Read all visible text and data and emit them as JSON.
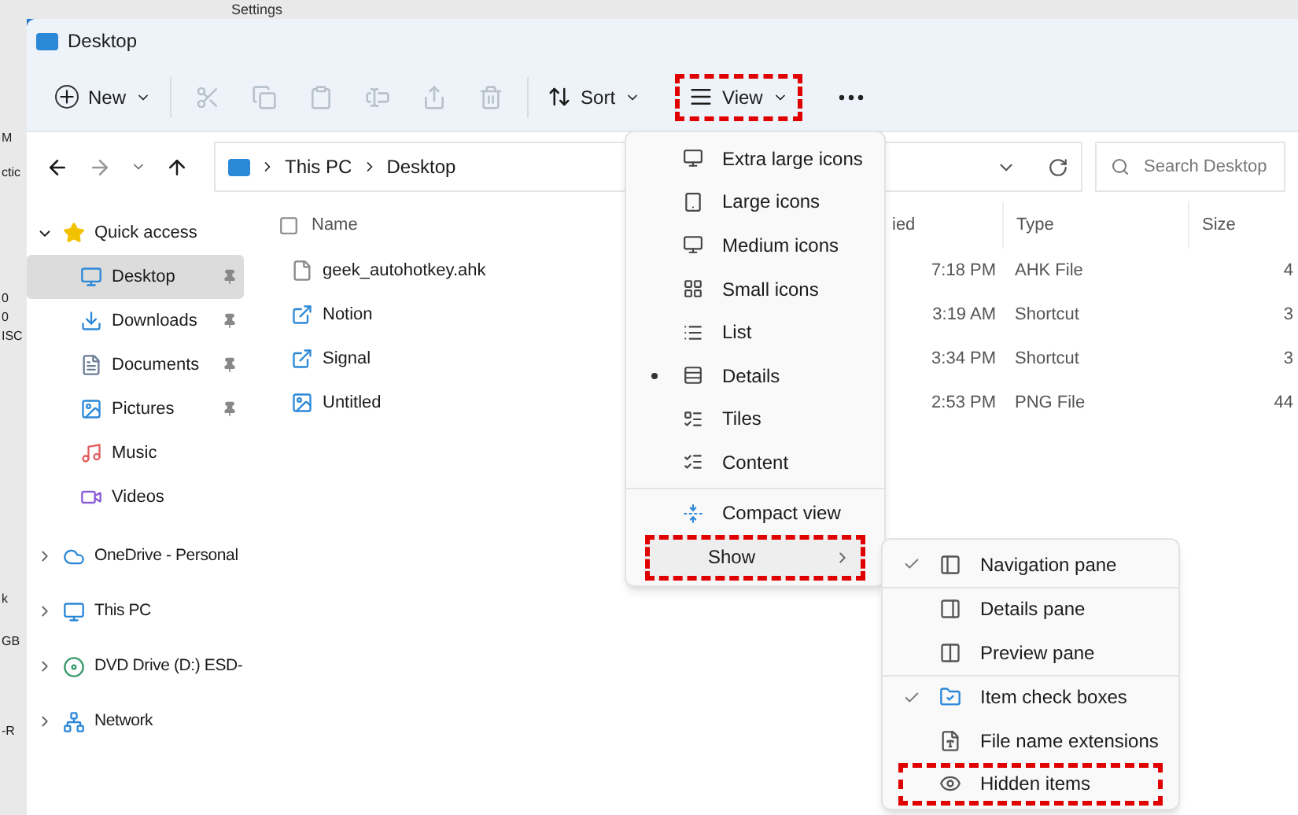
{
  "background": {
    "window_title": "Settings",
    "edge_texts": [
      "M",
      "ctic",
      "0",
      "0",
      "ISC",
      "k",
      "GB",
      "-R"
    ]
  },
  "window": {
    "title": "Desktop"
  },
  "toolbar": {
    "new": {
      "label": "New"
    },
    "actions": [
      {
        "disabled": true
      },
      {
        "disabled": true
      },
      {
        "disabled": true
      },
      {
        "disabled": true
      },
      {
        "disabled": true
      },
      {
        "disabled": true
      }
    ],
    "sort": {
      "label": "Sort"
    },
    "view": {
      "label": "View",
      "highlighted": true
    }
  },
  "address": {
    "path": [
      "This PC",
      "Desktop"
    ]
  },
  "search": {
    "placeholder": "Search Desktop"
  },
  "sidebar": {
    "items": [
      {
        "label": "Quick access",
        "expanded": true,
        "children": [
          {
            "label": "Desktop",
            "selected": true,
            "pinned": true
          },
          {
            "label": "Downloads",
            "selected": false,
            "pinned": true
          },
          {
            "label": "Documents",
            "selected": false,
            "pinned": true
          },
          {
            "label": "Pictures",
            "selected": false,
            "pinned": true
          },
          {
            "label": "Music",
            "selected": false,
            "pinned": false
          },
          {
            "label": "Videos",
            "selected": false,
            "pinned": false
          }
        ]
      },
      {
        "label": "OneDrive - Personal",
        "expanded": false
      },
      {
        "label": "This PC",
        "expanded": false
      },
      {
        "label": "DVD Drive (D:) ESD-",
        "expanded": false
      },
      {
        "label": "Network",
        "expanded": false
      }
    ]
  },
  "file_list": {
    "columns": [
      "Name",
      "ied",
      "Type",
      "Size"
    ],
    "rows": [
      {
        "name": "geek_autohotkey.ahk",
        "column_2": "7:18 PM",
        "type": "AHK File",
        "size": "4"
      },
      {
        "name": "Notion",
        "column_2": "3:19 AM",
        "type": "Shortcut",
        "size": "3"
      },
      {
        "name": "Signal",
        "column_2": "3:34 PM",
        "type": "Shortcut",
        "size": "3"
      },
      {
        "name": "Untitled",
        "column_2": "2:53 PM",
        "type": "PNG File",
        "size": "44"
      }
    ]
  },
  "view_menu": {
    "layouts": [
      {
        "label": "Extra large icons",
        "selected": false
      },
      {
        "label": "Large icons",
        "selected": false
      },
      {
        "label": "Medium icons",
        "selected": false
      },
      {
        "label": "Small icons",
        "selected": false
      },
      {
        "label": "List",
        "selected": false
      },
      {
        "label": "Details",
        "selected": true
      },
      {
        "label": "Tiles",
        "selected": false
      },
      {
        "label": "Content",
        "selected": false
      }
    ],
    "compact_view": {
      "label": "Compact view",
      "checked": false
    },
    "show": {
      "label": "Show",
      "highlighted": true
    }
  },
  "show_submenu": {
    "groups": [
      [
        {
          "label": "Navigation pane",
          "checked": true,
          "highlighted": false
        }
      ],
      [
        {
          "label": "Details pane",
          "checked": false,
          "highlighted": false
        },
        {
          "label": "Preview pane",
          "checked": false,
          "highlighted": false
        }
      ],
      [
        {
          "label": "Item check boxes",
          "checked": true,
          "highlighted": false
        },
        {
          "label": "File name extensions",
          "checked": false,
          "highlighted": false
        },
        {
          "label": "Hidden items",
          "checked": false,
          "highlighted": true
        }
      ]
    ]
  }
}
